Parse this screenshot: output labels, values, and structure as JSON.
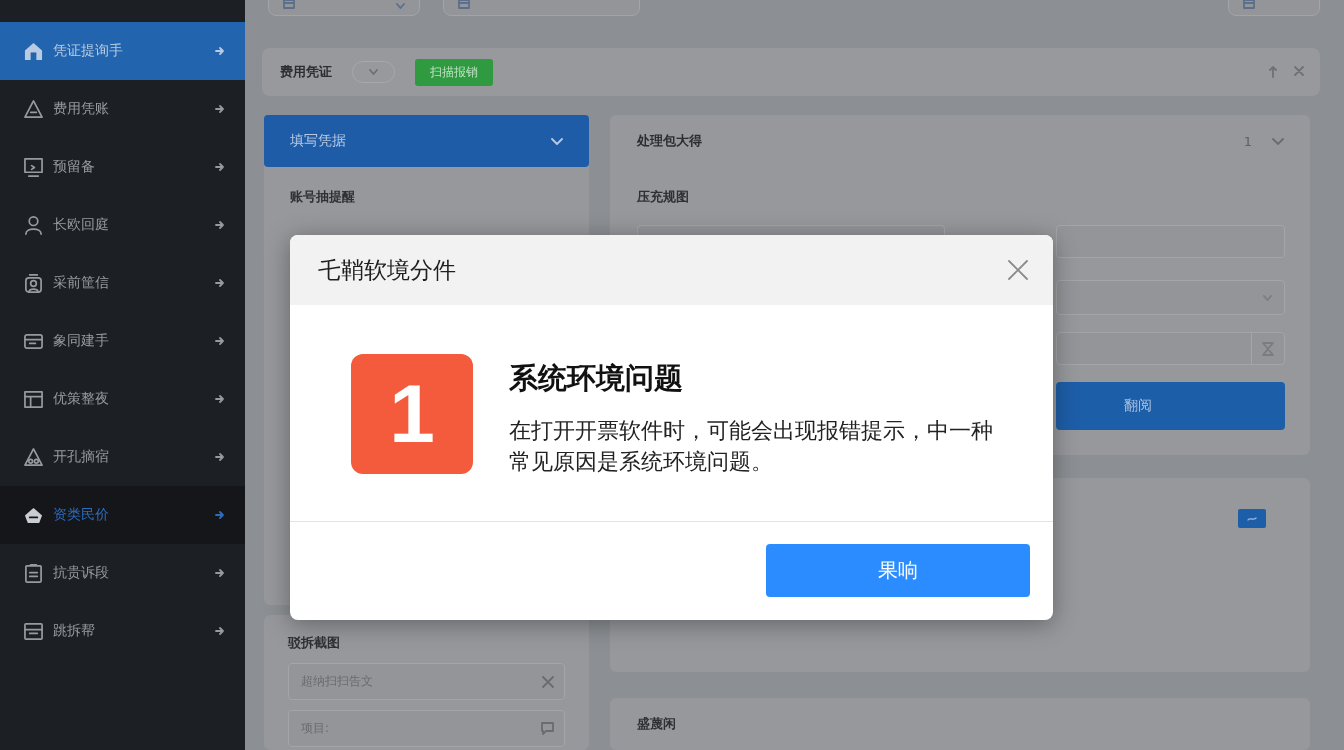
{
  "sidebar": {
    "items": [
      {
        "label": "凭证提询手",
        "selected": true,
        "active": false
      },
      {
        "label": "费用凭账",
        "selected": false,
        "active": false
      },
      {
        "label": "预留备",
        "selected": false,
        "active": false
      },
      {
        "label": "长欧回庭",
        "selected": false,
        "active": false
      },
      {
        "label": "采前筐信",
        "selected": false,
        "active": false
      },
      {
        "label": "象同建手",
        "selected": false,
        "active": false
      },
      {
        "label": "优策整夜",
        "selected": false,
        "active": false
      },
      {
        "label": "开孔摘宿",
        "selected": false,
        "active": false
      },
      {
        "label": "资类民价",
        "selected": false,
        "active": true
      },
      {
        "label": "抗贵诉段",
        "selected": false,
        "active": false
      },
      {
        "label": "跳拆帮",
        "selected": false,
        "active": false
      }
    ]
  },
  "filter_bar": {
    "label": "费用凭证",
    "button": "扫描报销"
  },
  "left_panel": {
    "header": "填写凭据",
    "expanded": true,
    "field_label": "账号抽提醒"
  },
  "attachments": {
    "label": "驳拆截图",
    "fields": [
      {
        "kind": "clear",
        "placeholder": "超纳扫扫告文"
      },
      {
        "kind": "note",
        "placeholder": "项目:"
      }
    ]
  },
  "right_panel": {
    "header": "处理包大得",
    "count": "1",
    "label": "压充规图",
    "button": "翻阅"
  },
  "notes_card": {
    "title": "盛蔑闲"
  },
  "dialog": {
    "title": "乇鞘软境分件",
    "badge": "1",
    "heading": "系统环境问题",
    "message": "在打开开票软件时，可能会出现报错提示，中一种常见原因是系统环境问题。",
    "button": "果响"
  }
}
